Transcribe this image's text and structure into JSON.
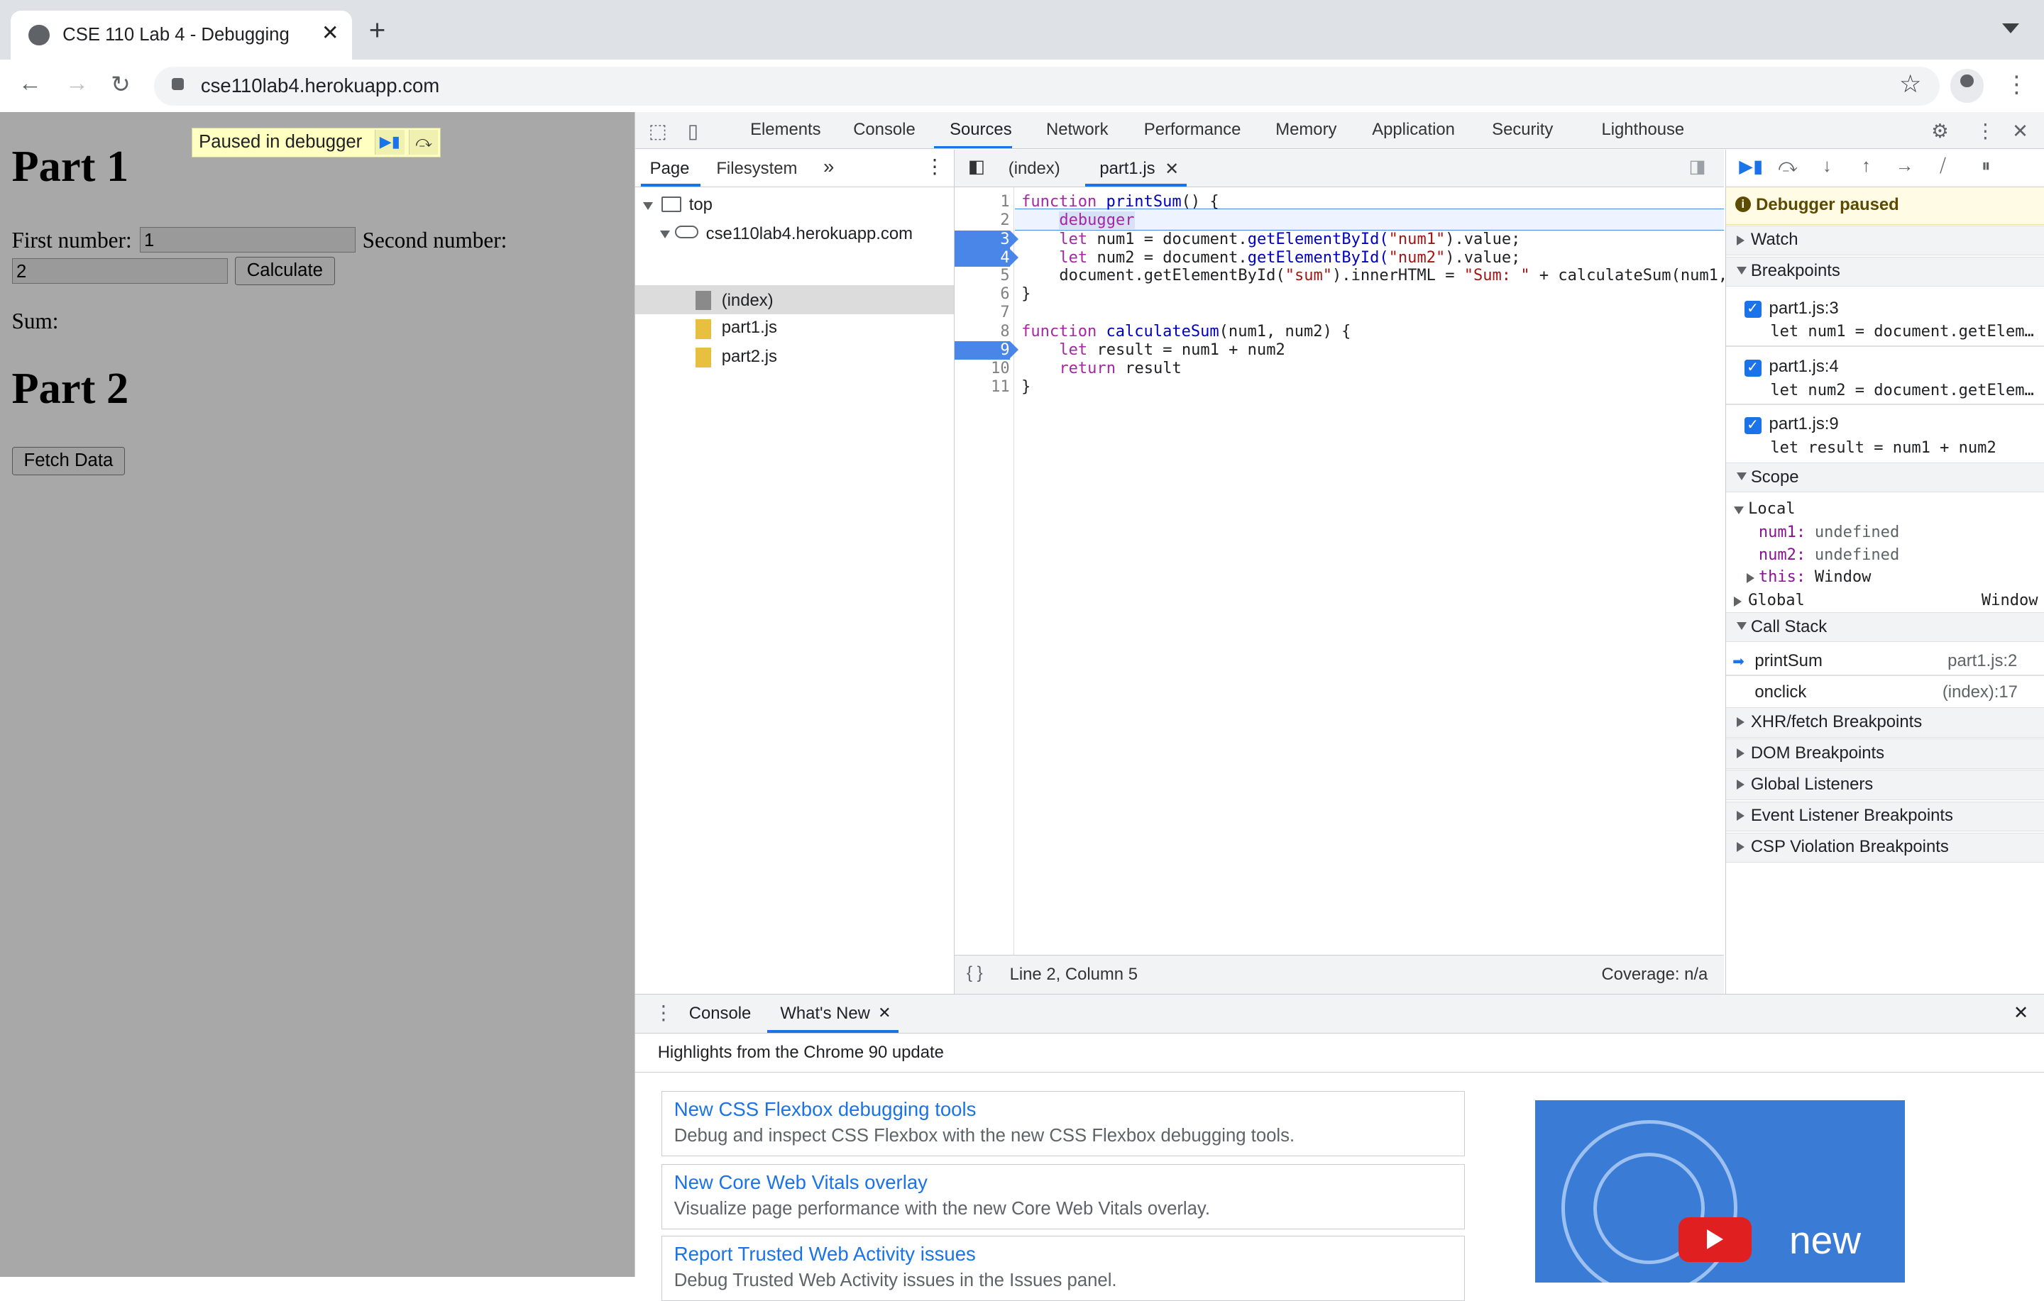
{
  "browser": {
    "tab_title": "CSE 110 Lab 4 - Debugging",
    "url": "cse110lab4.herokuapp.com"
  },
  "page": {
    "paused_label": "Paused in debugger",
    "part1_heading": "Part 1",
    "first_number_label": "First number:",
    "first_number_value": "1",
    "second_number_label": "Second number:",
    "second_number_value": "2",
    "calculate_label": "Calculate",
    "sum_label": "Sum:",
    "part2_heading": "Part 2",
    "fetch_label": "Fetch Data"
  },
  "devtools": {
    "tabs": [
      "Elements",
      "Console",
      "Sources",
      "Network",
      "Performance",
      "Memory",
      "Application",
      "Security",
      "Lighthouse"
    ],
    "active_tab": "Sources",
    "navigator": {
      "tabs": [
        "Page",
        "Filesystem"
      ],
      "top": "top",
      "domain": "cse110lab4.herokuapp.com",
      "files": [
        "(index)",
        "part1.js",
        "part2.js"
      ]
    },
    "editor": {
      "tabs": [
        "(index)",
        "part1.js"
      ],
      "line_numbers": [
        "1",
        "2",
        "3",
        "4",
        "5",
        "6",
        "7",
        "8",
        "9",
        "10",
        "11"
      ],
      "breakpoint_lines": [
        3,
        4,
        9
      ],
      "status_position": "Line 2, Column 5",
      "coverage": "Coverage: n/a",
      "code": {
        "l1a": "function ",
        "l1b": "printSum",
        "l1c": "() {",
        "l2": "debugger",
        "l3a": "let ",
        "l3b": "num1 = ",
        "l3c": "document.",
        "l3d": "getElementById(",
        "l3e": "\"num1\"",
        "l3f": ").value;",
        "l4a": "let ",
        "l4b": "num2 = ",
        "l4c": "document.",
        "l4d": "getElementById(",
        "l4e": "\"num2\"",
        "l4f": ").value;",
        "l5a": "document.getElementById(",
        "l5b": "\"sum\"",
        "l5c": ").innerHTML = ",
        "l5d": "\"Sum: \"",
        "l5e": " + calculateSum(num1,",
        "l6": "}",
        "l8a": "function ",
        "l8b": "calculateSum",
        "l8c": "(num1, num2) {",
        "l9a": "let ",
        "l9b": "result = num1 + num2",
        "l10a": "return ",
        "l10b": "result",
        "l11": "}"
      }
    },
    "debugger": {
      "paused": "Debugger paused",
      "watch": "Watch",
      "breakpoints": "Breakpoints",
      "bp_items": [
        {
          "file": "part1.js:3",
          "code": "let num1 = document.getElem…"
        },
        {
          "file": "part1.js:4",
          "code": "let num2 = document.getElem…"
        },
        {
          "file": "part1.js:9",
          "code": "let result = num1 + num2"
        }
      ],
      "scope": "Scope",
      "local": "Local",
      "num1_name": "num1:",
      "num1_val": "undefined",
      "num2_name": "num2:",
      "num2_val": "undefined",
      "this_name": "this:",
      "this_val": "Window",
      "global": "Global",
      "global_val": "Window",
      "call_stack": "Call Stack",
      "frames": [
        {
          "name": "printSum",
          "loc": "part1.js:2"
        },
        {
          "name": "onclick",
          "loc": "(index):17"
        }
      ],
      "other_sections": [
        "XHR/fetch Breakpoints",
        "DOM Breakpoints",
        "Global Listeners",
        "Event Listener Breakpoints",
        "CSP Violation Breakpoints"
      ]
    },
    "drawer": {
      "tabs": [
        "Console",
        "What's New"
      ],
      "highlights": "Highlights from the Chrome 90 update",
      "cards": [
        {
          "title": "New CSS Flexbox debugging tools",
          "desc": "Debug and inspect CSS Flexbox with the new CSS Flexbox debugging tools."
        },
        {
          "title": "New Core Web Vitals overlay",
          "desc": "Visualize page performance with the new Core Web Vitals overlay."
        },
        {
          "title": "Report Trusted Web Activity issues",
          "desc": "Debug Trusted Web Activity issues in the Issues panel."
        }
      ],
      "promo_text": "new"
    }
  },
  "colors": {
    "accent": "#1a73e8",
    "breakpoint": "#4a86e8",
    "page_overlay": "#a8a8a8"
  }
}
